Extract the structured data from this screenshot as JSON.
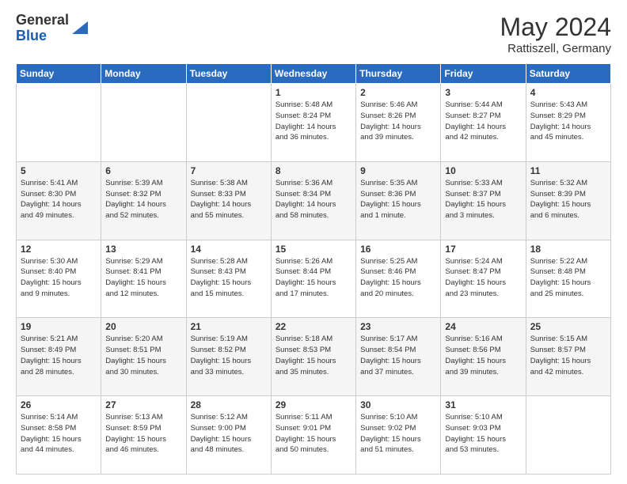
{
  "header": {
    "logo_general": "General",
    "logo_blue": "Blue",
    "month_title": "May 2024",
    "subtitle": "Rattiszell, Germany"
  },
  "days_of_week": [
    "Sunday",
    "Monday",
    "Tuesday",
    "Wednesday",
    "Thursday",
    "Friday",
    "Saturday"
  ],
  "weeks": [
    [
      {
        "day": "",
        "info": ""
      },
      {
        "day": "",
        "info": ""
      },
      {
        "day": "",
        "info": ""
      },
      {
        "day": "1",
        "info": "Sunrise: 5:48 AM\nSunset: 8:24 PM\nDaylight: 14 hours\nand 36 minutes."
      },
      {
        "day": "2",
        "info": "Sunrise: 5:46 AM\nSunset: 8:26 PM\nDaylight: 14 hours\nand 39 minutes."
      },
      {
        "day": "3",
        "info": "Sunrise: 5:44 AM\nSunset: 8:27 PM\nDaylight: 14 hours\nand 42 minutes."
      },
      {
        "day": "4",
        "info": "Sunrise: 5:43 AM\nSunset: 8:29 PM\nDaylight: 14 hours\nand 45 minutes."
      }
    ],
    [
      {
        "day": "5",
        "info": "Sunrise: 5:41 AM\nSunset: 8:30 PM\nDaylight: 14 hours\nand 49 minutes."
      },
      {
        "day": "6",
        "info": "Sunrise: 5:39 AM\nSunset: 8:32 PM\nDaylight: 14 hours\nand 52 minutes."
      },
      {
        "day": "7",
        "info": "Sunrise: 5:38 AM\nSunset: 8:33 PM\nDaylight: 14 hours\nand 55 minutes."
      },
      {
        "day": "8",
        "info": "Sunrise: 5:36 AM\nSunset: 8:34 PM\nDaylight: 14 hours\nand 58 minutes."
      },
      {
        "day": "9",
        "info": "Sunrise: 5:35 AM\nSunset: 8:36 PM\nDaylight: 15 hours\nand 1 minute."
      },
      {
        "day": "10",
        "info": "Sunrise: 5:33 AM\nSunset: 8:37 PM\nDaylight: 15 hours\nand 3 minutes."
      },
      {
        "day": "11",
        "info": "Sunrise: 5:32 AM\nSunset: 8:39 PM\nDaylight: 15 hours\nand 6 minutes."
      }
    ],
    [
      {
        "day": "12",
        "info": "Sunrise: 5:30 AM\nSunset: 8:40 PM\nDaylight: 15 hours\nand 9 minutes."
      },
      {
        "day": "13",
        "info": "Sunrise: 5:29 AM\nSunset: 8:41 PM\nDaylight: 15 hours\nand 12 minutes."
      },
      {
        "day": "14",
        "info": "Sunrise: 5:28 AM\nSunset: 8:43 PM\nDaylight: 15 hours\nand 15 minutes."
      },
      {
        "day": "15",
        "info": "Sunrise: 5:26 AM\nSunset: 8:44 PM\nDaylight: 15 hours\nand 17 minutes."
      },
      {
        "day": "16",
        "info": "Sunrise: 5:25 AM\nSunset: 8:46 PM\nDaylight: 15 hours\nand 20 minutes."
      },
      {
        "day": "17",
        "info": "Sunrise: 5:24 AM\nSunset: 8:47 PM\nDaylight: 15 hours\nand 23 minutes."
      },
      {
        "day": "18",
        "info": "Sunrise: 5:22 AM\nSunset: 8:48 PM\nDaylight: 15 hours\nand 25 minutes."
      }
    ],
    [
      {
        "day": "19",
        "info": "Sunrise: 5:21 AM\nSunset: 8:49 PM\nDaylight: 15 hours\nand 28 minutes."
      },
      {
        "day": "20",
        "info": "Sunrise: 5:20 AM\nSunset: 8:51 PM\nDaylight: 15 hours\nand 30 minutes."
      },
      {
        "day": "21",
        "info": "Sunrise: 5:19 AM\nSunset: 8:52 PM\nDaylight: 15 hours\nand 33 minutes."
      },
      {
        "day": "22",
        "info": "Sunrise: 5:18 AM\nSunset: 8:53 PM\nDaylight: 15 hours\nand 35 minutes."
      },
      {
        "day": "23",
        "info": "Sunrise: 5:17 AM\nSunset: 8:54 PM\nDaylight: 15 hours\nand 37 minutes."
      },
      {
        "day": "24",
        "info": "Sunrise: 5:16 AM\nSunset: 8:56 PM\nDaylight: 15 hours\nand 39 minutes."
      },
      {
        "day": "25",
        "info": "Sunrise: 5:15 AM\nSunset: 8:57 PM\nDaylight: 15 hours\nand 42 minutes."
      }
    ],
    [
      {
        "day": "26",
        "info": "Sunrise: 5:14 AM\nSunset: 8:58 PM\nDaylight: 15 hours\nand 44 minutes."
      },
      {
        "day": "27",
        "info": "Sunrise: 5:13 AM\nSunset: 8:59 PM\nDaylight: 15 hours\nand 46 minutes."
      },
      {
        "day": "28",
        "info": "Sunrise: 5:12 AM\nSunset: 9:00 PM\nDaylight: 15 hours\nand 48 minutes."
      },
      {
        "day": "29",
        "info": "Sunrise: 5:11 AM\nSunset: 9:01 PM\nDaylight: 15 hours\nand 50 minutes."
      },
      {
        "day": "30",
        "info": "Sunrise: 5:10 AM\nSunset: 9:02 PM\nDaylight: 15 hours\nand 51 minutes."
      },
      {
        "day": "31",
        "info": "Sunrise: 5:10 AM\nSunset: 9:03 PM\nDaylight: 15 hours\nand 53 minutes."
      },
      {
        "day": "",
        "info": ""
      }
    ]
  ]
}
